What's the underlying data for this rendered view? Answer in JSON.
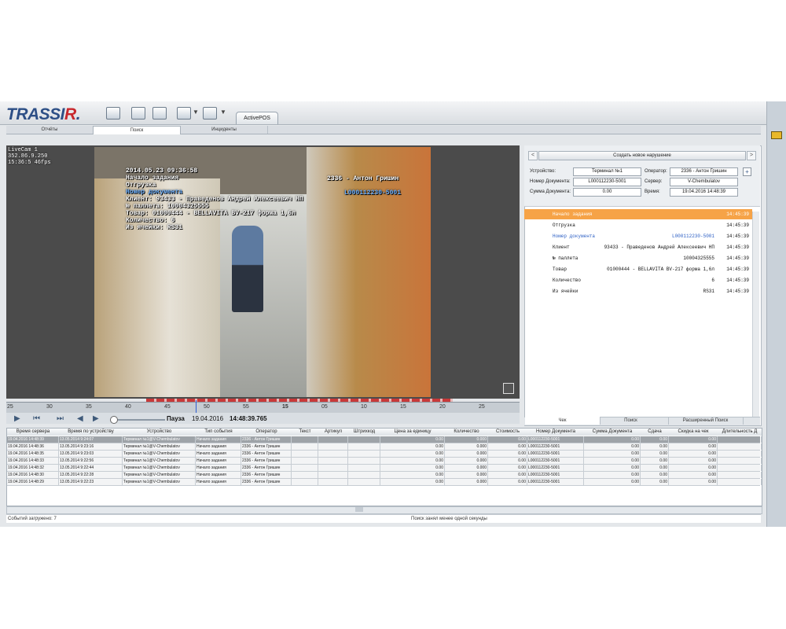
{
  "app": {
    "logo_main": "TRASSI",
    "logo_r": "R",
    "logo_dot": ".",
    "active_tab": "ActivePOS",
    "tabs": [
      "Отчёты",
      "Поиск",
      "Инциденты"
    ]
  },
  "video": {
    "corner_lines": [
      "LiveCam 1",
      "352.86.9.250",
      "15:36:5 46fps"
    ],
    "overlay": [
      {
        "text": "2014.05.23 09:36:58",
        "color": "white"
      },
      {
        "text": "Начало задания",
        "color": "white"
      },
      {
        "text": "Отгрузка",
        "color": "white"
      },
      {
        "text": "Номер документа",
        "color": "blue"
      },
      {
        "text": "Клиент: 93433 - Праведенов Андрей Алексеевич НП",
        "color": "white"
      },
      {
        "text": "№ паллета: 10004325555",
        "color": "white"
      },
      {
        "text": "Товар: 01000444 - BELLAVITA BV-217 форма 1,6л",
        "color": "white"
      },
      {
        "text": "Количество: 6",
        "color": "white"
      },
      {
        "text": "Из ячейки: RS31",
        "color": "white"
      }
    ],
    "overlay_operator": "2336 - Антон Гришин",
    "overlay_docno": "L000112230-5001"
  },
  "timeline": {
    "ticks": [
      "25",
      "30",
      "35",
      "40",
      "45",
      "50",
      "55",
      "15",
      "05",
      "10",
      "15",
      "20",
      "25"
    ]
  },
  "controls": {
    "state": "Пауза",
    "date": "19.04.2016",
    "time": "14:48:39.765"
  },
  "right_panel": {
    "create_button": "Создать новое нарушение",
    "fields": {
      "device_label": "Устройство:",
      "device_value": "Терминал №1",
      "operator_label": "Оператор:",
      "operator_value": "2336 - Антон Гришин",
      "docno_label": "Номер Документа:",
      "docno_value": "L000112230-5001",
      "server_label": "Сервер:",
      "server_value": "V-Chembulatov",
      "sum_label": "Сумма Документа:",
      "sum_value": "0.00",
      "time_label": "Время:",
      "time_value": "19.04.2016 14:48:39"
    },
    "log": [
      {
        "label": "Начало задания",
        "value": "",
        "time": "14:45:39",
        "style": "hl"
      },
      {
        "label": "Отгрузка",
        "value": "",
        "time": "14:45:39",
        "style": ""
      },
      {
        "label": "Номер документа",
        "value": "L000112230-5001",
        "time": "14:45:39",
        "style": "blue"
      },
      {
        "label": "Клиент",
        "value": "93433 - Праведенов Андрей Алексеевич НП",
        "time": "14:45:39",
        "style": ""
      },
      {
        "label": "№ паллета",
        "value": "10004325555",
        "time": "14:45:39",
        "style": ""
      },
      {
        "label": "Товар",
        "value": "01000444 - BELLAVITA BV-217 форма 1,6л",
        "time": "14:45:39",
        "style": ""
      },
      {
        "label": "Количество",
        "value": "6",
        "time": "14:45:39",
        "style": ""
      },
      {
        "label": "Из ячейки",
        "value": "RS31",
        "time": "14:45:39",
        "style": ""
      }
    ],
    "subtabs": [
      "Чек",
      "Поиск",
      "Расширенный Поиск"
    ]
  },
  "table": {
    "headers": [
      "Время сервера",
      "Время по устройству",
      "Устройство",
      "Тип события",
      "Оператор",
      "Текст",
      "Артикул",
      "Штрихкод",
      "Цена за единицу",
      "Количество",
      "Стоимость",
      "Номер Документа",
      "Сумма Документа",
      "Сдача",
      "Скидка на чек",
      "Длительность Д"
    ],
    "rows": [
      [
        "19.04.2016 14:48:39",
        "13.05.2014 9:24:07",
        "Терминал №1@V-Chembulatov",
        "Начало задания",
        "2336 - Антон Гришин",
        "",
        "",
        "",
        "0.00",
        "0.000",
        "0.00",
        "L000112230-5001",
        "0.00",
        "0.00",
        "0.00",
        ""
      ],
      [
        "19.04.2016 14:48:36",
        "13.05.2014 9:23:16",
        "Терминал №1@V-Chembulatov",
        "Начало задания",
        "2336 - Антон Гришин",
        "",
        "",
        "",
        "0.00",
        "0.000",
        "0.00",
        "L000112230-5001",
        "0.00",
        "0.00",
        "0.00",
        ""
      ],
      [
        "19.04.2016 14:48:35",
        "13.05.2014 9:23:03",
        "Терминал №1@V-Chembulatov",
        "Начало задания",
        "2336 - Антон Гришин",
        "",
        "",
        "",
        "0.00",
        "0.000",
        "0.00",
        "L000112230-5001",
        "0.00",
        "0.00",
        "0.00",
        ""
      ],
      [
        "19.04.2016 14:48:33",
        "13.05.2014 9:22:56",
        "Терминал №1@V-Chembulatov",
        "Начало задания",
        "2336 - Антон Гришин",
        "",
        "",
        "",
        "0.00",
        "0.000",
        "0.00",
        "L000112230-5001",
        "0.00",
        "0.00",
        "0.00",
        ""
      ],
      [
        "19.04.2016 14:48:32",
        "13.05.2014 9:22:44",
        "Терминал №1@V-Chembulatov",
        "Начало задания",
        "2336 - Антон Гришин",
        "",
        "",
        "",
        "0.00",
        "0.000",
        "0.00",
        "L000112230-5001",
        "0.00",
        "0.00",
        "0.00",
        ""
      ],
      [
        "19.04.2016 14:48:30",
        "13.05.2014 9:22:28",
        "Терминал №1@V-Chembulatov",
        "Начало задания",
        "2336 - Антон Гришин",
        "",
        "",
        "",
        "0.00",
        "0.000",
        "0.00",
        "L000112230-5001",
        "0.00",
        "0.00",
        "0.00",
        ""
      ],
      [
        "19.04.2016 14:48:29",
        "13.05.2014 9:22:23",
        "Терминал №1@V-Chembulatov",
        "Начало задания",
        "2336 - Антон Гришин",
        "",
        "",
        "",
        "0.00",
        "0.000",
        "0.00",
        "L000112230-5001",
        "0.00",
        "0.00",
        "0.00",
        ""
      ]
    ]
  },
  "status": {
    "left": "Событий загружено: 7",
    "right": "Поиск занял менее одной секунды"
  }
}
